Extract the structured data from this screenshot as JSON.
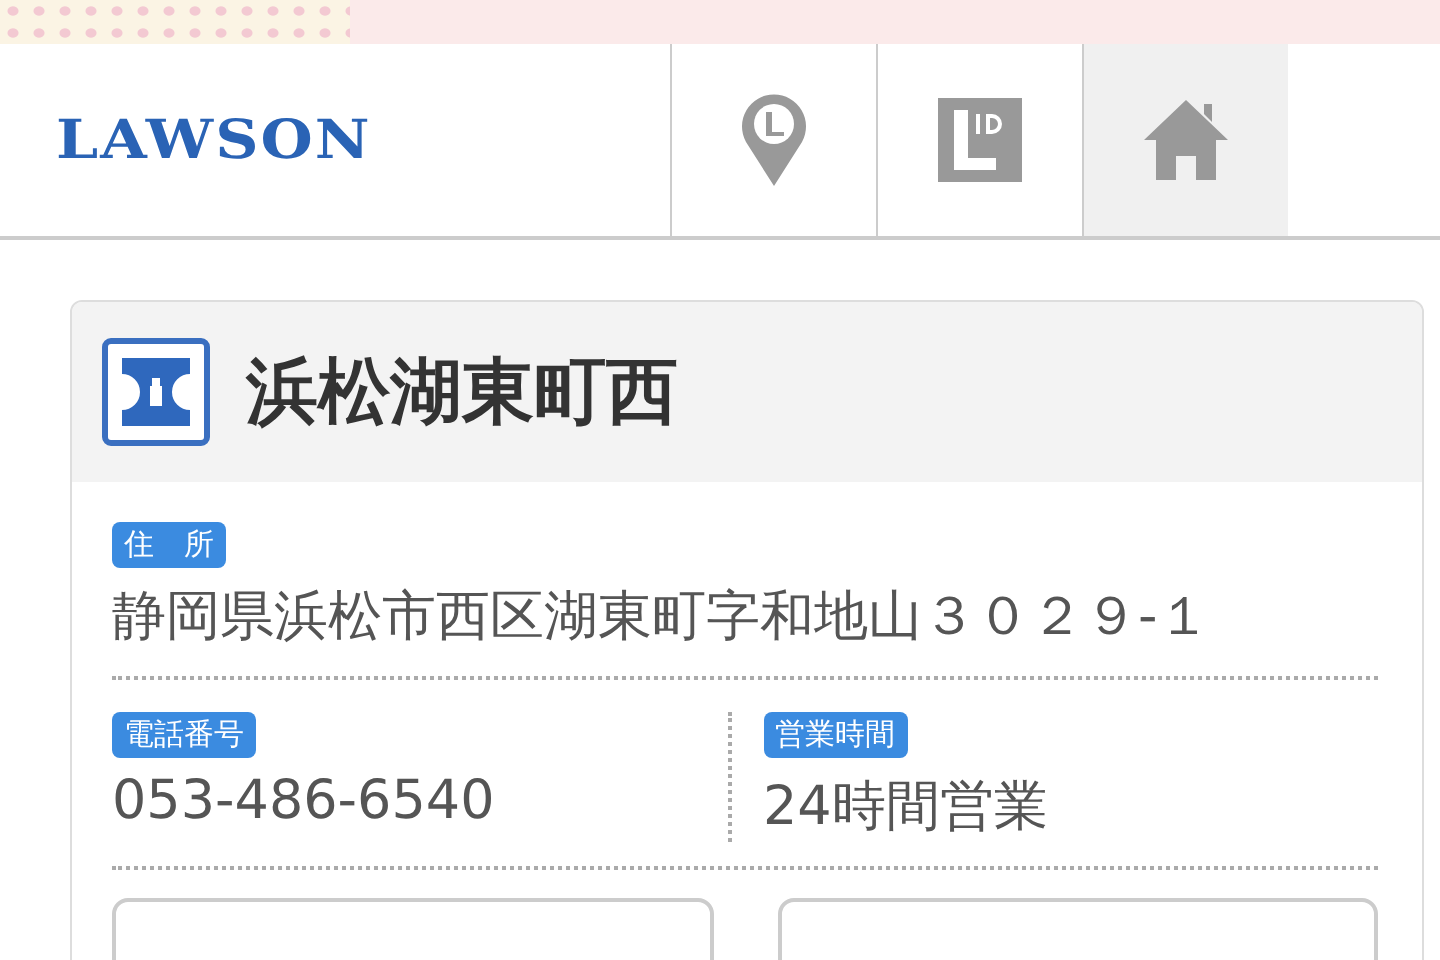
{
  "header": {
    "logo": "LAWSON",
    "nav": [
      {
        "kind": "pin",
        "selected": false
      },
      {
        "kind": "id",
        "selected": false
      },
      {
        "kind": "home",
        "selected": true
      }
    ]
  },
  "store": {
    "name": "浜松湖東町西",
    "fields": [
      {
        "label": "住　所",
        "value": "静岡県浜松市西区湖東町字和地山３０２９-１"
      },
      {
        "label": "電話番号",
        "value": "053-486-6540"
      },
      {
        "label": "営業時間",
        "value": "24時間営業"
      }
    ]
  }
}
